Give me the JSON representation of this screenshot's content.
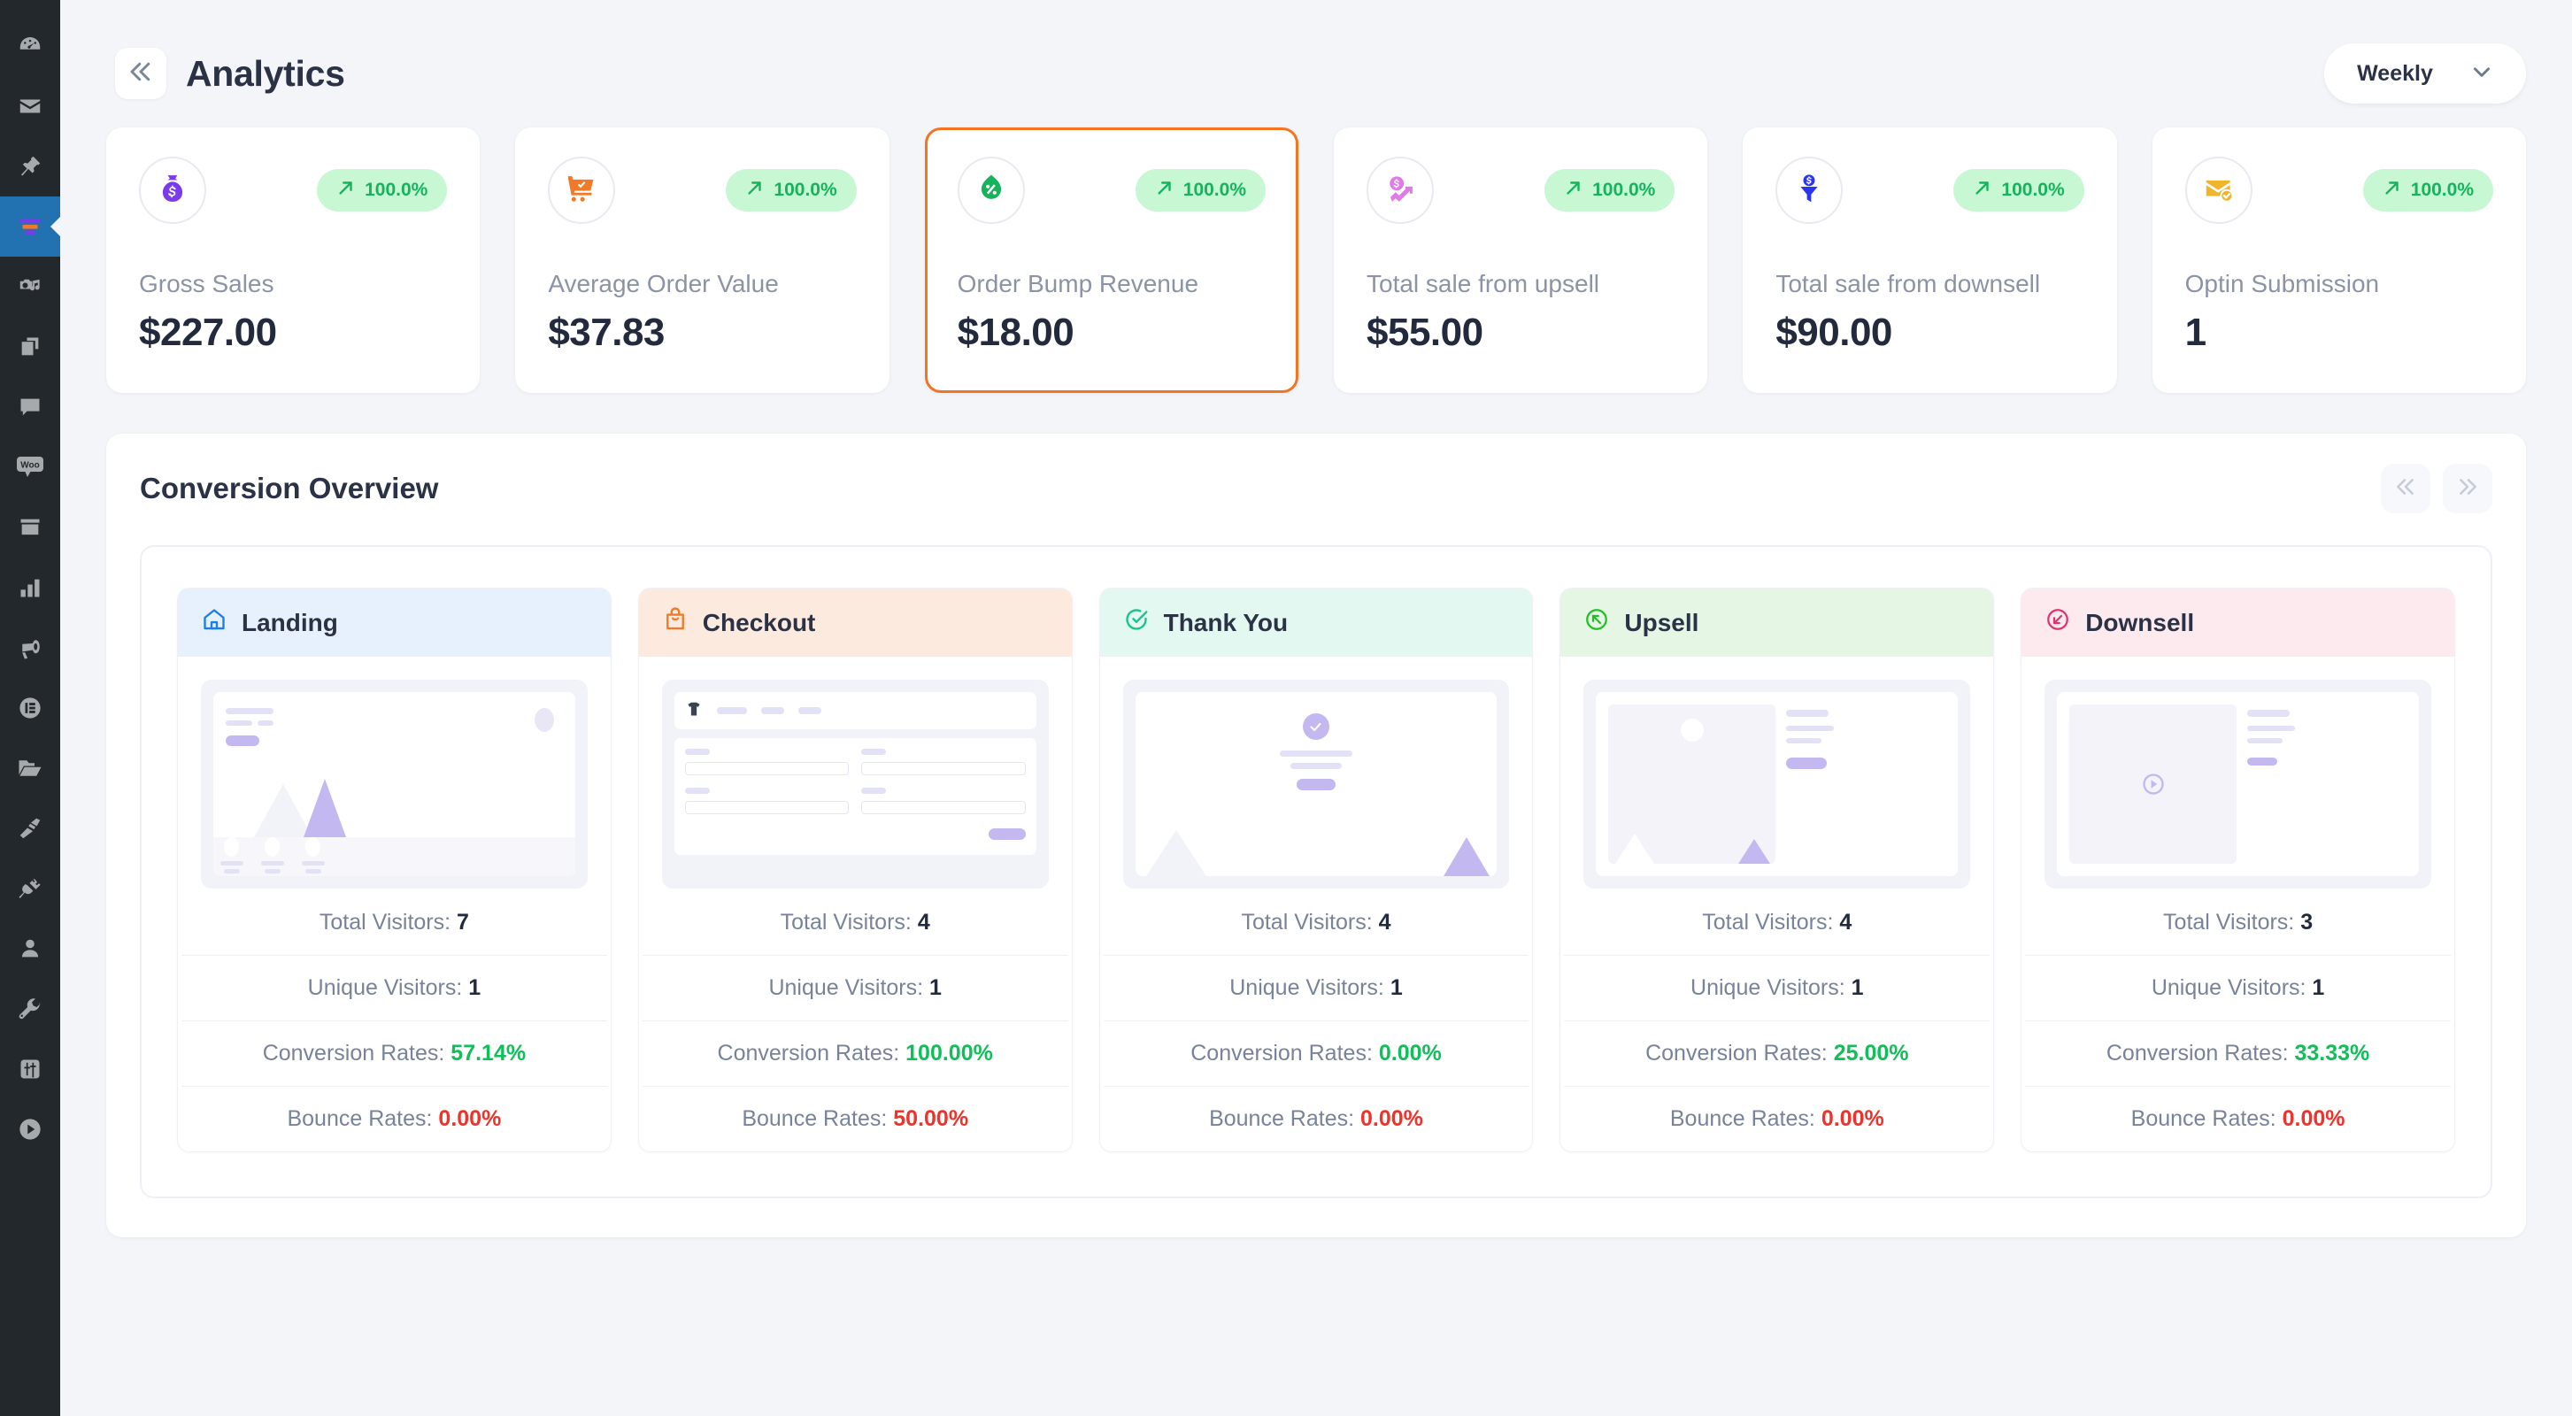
{
  "sidebar": {
    "items": [
      {
        "name": "dashboard",
        "icon": "gauge-icon",
        "active": false
      },
      {
        "name": "mail",
        "icon": "envelope-icon",
        "active": false
      },
      {
        "name": "pin",
        "icon": "pin-icon",
        "active": false
      },
      {
        "name": "funnels",
        "icon": "funnel-icon",
        "active": true
      },
      {
        "name": "media",
        "icon": "camera-music-icon",
        "active": false
      },
      {
        "name": "pages",
        "icon": "copy-pages-icon",
        "active": false
      },
      {
        "name": "comments",
        "icon": "comment-icon",
        "active": false
      },
      {
        "name": "woocommerce",
        "icon": "woo-icon",
        "active": false
      },
      {
        "name": "archive",
        "icon": "archive-box-icon",
        "active": false
      },
      {
        "name": "analytics",
        "icon": "bar-chart-icon",
        "active": false
      },
      {
        "name": "marketing",
        "icon": "megaphone-icon",
        "active": false
      },
      {
        "name": "elementor",
        "icon": "elementor-icon",
        "active": false
      },
      {
        "name": "files",
        "icon": "folder-open-icon",
        "active": false
      },
      {
        "name": "appearance",
        "icon": "paint-brush-icon",
        "active": false
      },
      {
        "name": "plugins",
        "icon": "plug-icon",
        "active": false
      },
      {
        "name": "users",
        "icon": "user-icon",
        "active": false
      },
      {
        "name": "tools",
        "icon": "wrench-icon",
        "active": false
      },
      {
        "name": "settings",
        "icon": "sliders-icon",
        "active": false
      },
      {
        "name": "video",
        "icon": "play-circle-icon",
        "active": false
      }
    ]
  },
  "header": {
    "collapse_icon": "double-chevron-left-icon",
    "title": "Analytics",
    "period": {
      "label": "Weekly",
      "chevron_icon": "chevron-down-icon"
    }
  },
  "stats": [
    {
      "icon": "money-bag-icon",
      "icon_color": "#7c3aed",
      "badge": "100.0%",
      "badge_trend_icon": "arrow-up-right-icon",
      "label": "Gross Sales",
      "value": "$227.00",
      "selected": false
    },
    {
      "icon": "shopping-cart-check-icon",
      "icon_color": "#f07a28",
      "badge": "100.0%",
      "badge_trend_icon": "arrow-up-right-icon",
      "label": "Average Order Value",
      "value": "$37.83",
      "selected": false
    },
    {
      "icon": "discount-leaf-icon",
      "icon_color": "#16b35c",
      "badge": "100.0%",
      "badge_trend_icon": "arrow-up-right-icon",
      "label": "Order Bump Revenue",
      "value": "$18.00",
      "selected": true
    },
    {
      "icon": "upsell-coin-chart-icon",
      "icon_color": "#e07ae8",
      "badge": "100.0%",
      "badge_trend_icon": "arrow-up-right-icon",
      "label": "Total sale from upsell",
      "value": "$55.00",
      "selected": false
    },
    {
      "icon": "downsell-funnel-icon",
      "icon_color": "#2a35f0",
      "badge": "100.0%",
      "badge_trend_icon": "arrow-up-right-icon",
      "label": "Total sale from downsell",
      "value": "$90.00",
      "selected": false
    },
    {
      "icon": "envelope-check-icon",
      "icon_color": "#edb62c",
      "badge": "100.0%",
      "badge_trend_icon": "arrow-up-right-icon",
      "label": "Optin Submission",
      "value": "1",
      "selected": false
    }
  ],
  "conversion": {
    "title": "Conversion Overview",
    "prev_icon": "double-chevron-left-icon",
    "next_icon": "double-chevron-right-icon",
    "accent_selected": "#f47521",
    "steps": [
      {
        "label": "Landing",
        "icon": "home-icon",
        "icon_color": "#1b7fe8",
        "header_bg": "#e7f0fd",
        "mock": "landing",
        "rows": [
          {
            "label": "Total Visitors:",
            "value": "7",
            "style": "dark"
          },
          {
            "label": "Unique Visitors:",
            "value": "1",
            "style": "dark"
          },
          {
            "label": "Conversion Rates:",
            "value": "57.14%",
            "style": "green"
          },
          {
            "label": "Bounce Rates:",
            "value": "0.00%",
            "style": "red"
          }
        ]
      },
      {
        "label": "Checkout",
        "icon": "shopping-bag-icon",
        "icon_color": "#f07a28",
        "header_bg": "#fdeade",
        "mock": "checkout",
        "rows": [
          {
            "label": "Total Visitors:",
            "value": "4",
            "style": "dark"
          },
          {
            "label": "Unique Visitors:",
            "value": "1",
            "style": "dark"
          },
          {
            "label": "Conversion Rates:",
            "value": "100.00%",
            "style": "green"
          },
          {
            "label": "Bounce Rates:",
            "value": "50.00%",
            "style": "red"
          }
        ]
      },
      {
        "label": "Thank You",
        "icon": "check-circle-icon",
        "icon_color": "#19c48a",
        "header_bg": "#e2f8f0",
        "mock": "thankyou",
        "rows": [
          {
            "label": "Total Visitors:",
            "value": "4",
            "style": "dark"
          },
          {
            "label": "Unique Visitors:",
            "value": "1",
            "style": "dark"
          },
          {
            "label": "Conversion Rates:",
            "value": "0.00%",
            "style": "green"
          },
          {
            "label": "Bounce Rates:",
            "value": "0.00%",
            "style": "red"
          }
        ]
      },
      {
        "label": "Upsell",
        "icon": "arrow-up-left-circle-icon",
        "icon_color": "#20c020",
        "header_bg": "#e6f6e4",
        "mock": "upsell",
        "rows": [
          {
            "label": "Total Visitors:",
            "value": "4",
            "style": "dark"
          },
          {
            "label": "Unique Visitors:",
            "value": "1",
            "style": "dark"
          },
          {
            "label": "Conversion Rates:",
            "value": "25.00%",
            "style": "green"
          },
          {
            "label": "Bounce Rates:",
            "value": "0.00%",
            "style": "red"
          }
        ]
      },
      {
        "label": "Downsell",
        "icon": "arrow-down-left-circle-icon",
        "icon_color": "#e0336a",
        "header_bg": "#fdeaee",
        "mock": "downsell",
        "rows": [
          {
            "label": "Total Visitors:",
            "value": "3",
            "style": "dark"
          },
          {
            "label": "Unique Visitors:",
            "value": "1",
            "style": "dark"
          },
          {
            "label": "Conversion Rates:",
            "value": "33.33%",
            "style": "green"
          },
          {
            "label": "Bounce Rates:",
            "value": "0.00%",
            "style": "red"
          }
        ]
      }
    ]
  }
}
